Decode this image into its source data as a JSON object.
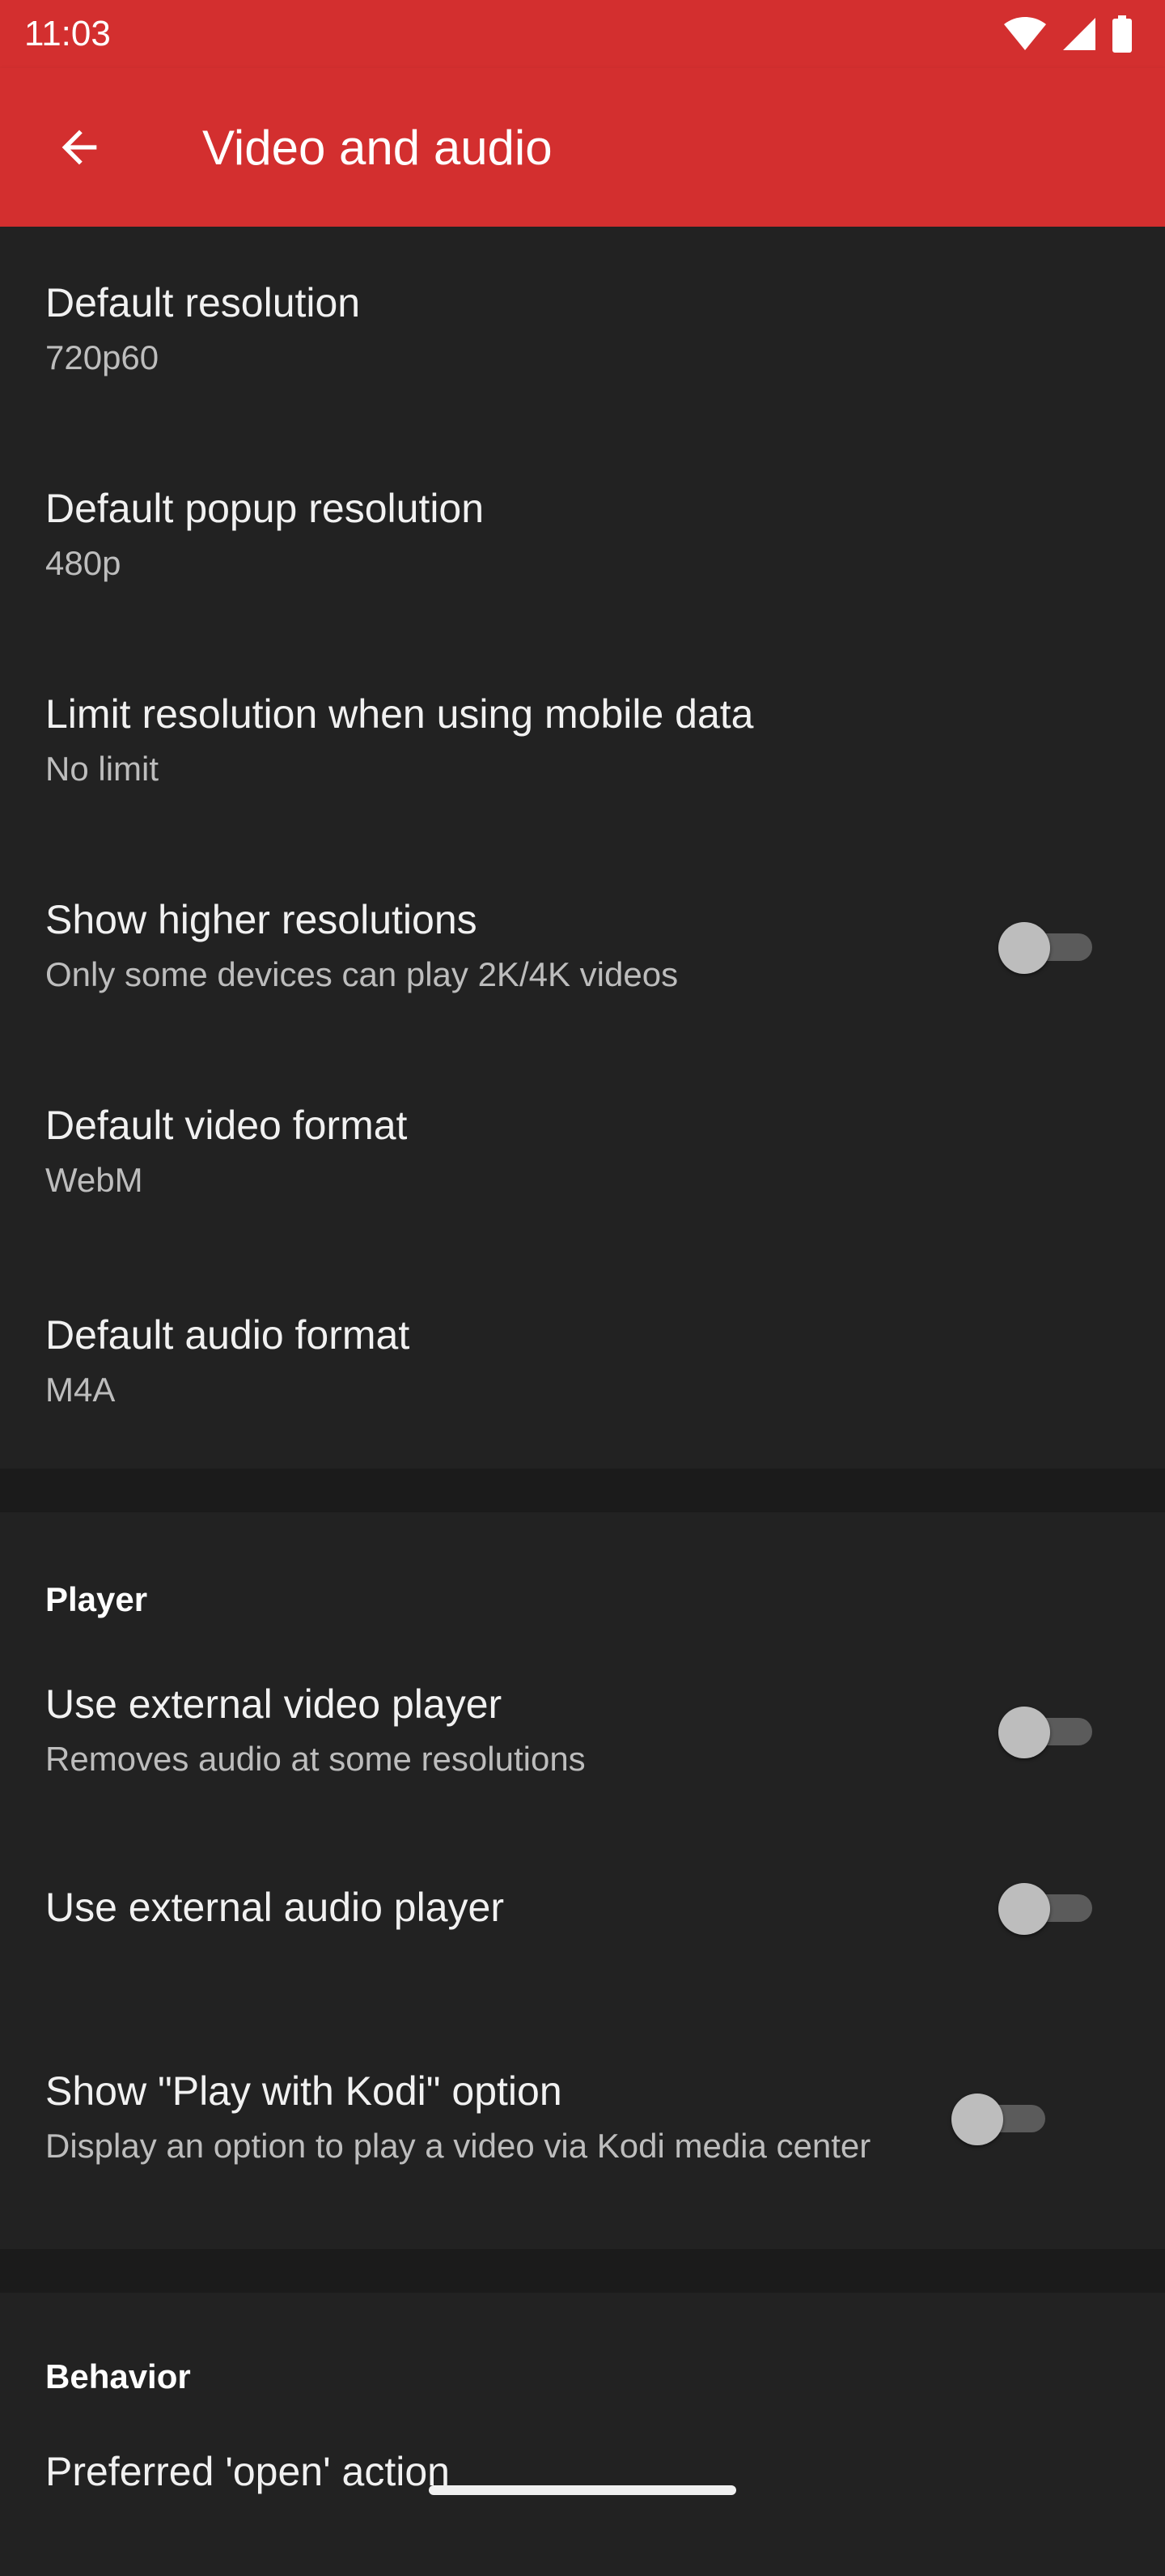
{
  "status_bar": {
    "time": "11:03",
    "icons": [
      "wifi-icon",
      "cellular-signal-icon",
      "battery-icon"
    ]
  },
  "app_bar": {
    "title": "Video and audio",
    "back_icon": "arrow-back-icon",
    "color": "#d32f2f"
  },
  "video_section": {
    "items": [
      {
        "title": "Default resolution",
        "summary": "720p60"
      },
      {
        "title": "Default popup resolution",
        "summary": "480p"
      },
      {
        "title": "Limit resolution when using mobile data",
        "summary": "No limit"
      },
      {
        "title": "Show higher resolutions",
        "summary": "Only some devices can play 2K/4K videos",
        "switch": false
      },
      {
        "title": "Default video format",
        "summary": "WebM"
      },
      {
        "title": "Default audio format",
        "summary": "M4A"
      }
    ]
  },
  "player_section": {
    "header": "Player",
    "items": [
      {
        "title": "Use external video player",
        "summary": "Removes audio at some resolutions",
        "switch": false
      },
      {
        "title": "Use external audio player",
        "switch": false
      },
      {
        "title": "Show \"Play with Kodi\" option",
        "summary": "Display an option to play a video via Kodi media center",
        "switch": false
      }
    ]
  },
  "behavior_section": {
    "header": "Behavior",
    "items": [
      {
        "title": "Preferred 'open' action"
      }
    ]
  }
}
